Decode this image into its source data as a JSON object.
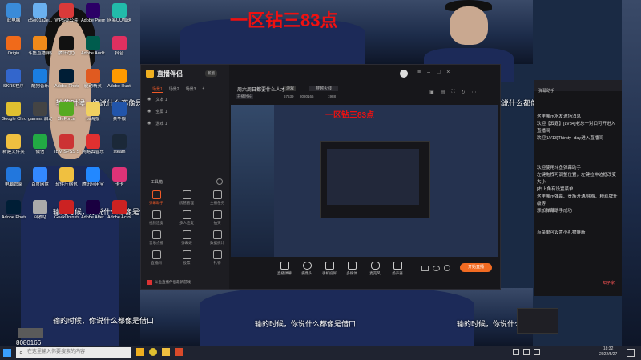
{
  "overlay": {
    "title_text": "一区钻三83点",
    "title_text_small": "一区钻三83点",
    "subtitle": "输的时候，你说什么都像是借口",
    "viewer_count": "8080166",
    "notice_text": "知子家"
  },
  "desktop_icons": [
    {
      "label": "此电脑",
      "color": "#3a8bd9"
    },
    {
      "label": "d5ei01a2e...",
      "color": "#6ab0f0"
    },
    {
      "label": "WPS办公套",
      "color": "#d93a3a"
    },
    {
      "label": "Adobe Premie...",
      "color": "#2b0066"
    },
    {
      "label": "网易UU加速器",
      "color": "#22bbaa"
    },
    {
      "label": "Origin",
      "color": "#f06a1a"
    },
    {
      "label": "斗鱼直播伴侣",
      "color": "#f08a1a"
    },
    {
      "label": "腾讯QQ",
      "color": "#111111"
    },
    {
      "label": "Adobe Audition",
      "color": "#005c4d"
    },
    {
      "label": "抖音",
      "color": "#e03060"
    },
    {
      "label": "SKRS程序",
      "color": "#3366cc"
    },
    {
      "label": "酷狗音乐",
      "color": "#1a7de0"
    },
    {
      "label": "Adobe Photoshop",
      "color": "#001e36"
    },
    {
      "label": "驱动精灵",
      "color": "#e05a20"
    },
    {
      "label": "Adobe Illustrator",
      "color": "#ff9a00"
    },
    {
      "label": "Google Chrome",
      "color": "#e0c030"
    },
    {
      "label": "gamma 启动器",
      "color": "#444444"
    },
    {
      "label": "GeForce",
      "color": "#55aa22"
    },
    {
      "label": "ps海报",
      "color": "#f0d060"
    },
    {
      "label": "豪华版",
      "color": "#2255aa"
    },
    {
      "label": "新建文件夹",
      "color": "#f0c040"
    },
    {
      "label": "微信",
      "color": "#22aa44"
    },
    {
      "label": "IBM SPSS Statistics 26",
      "color": "#cc3333"
    },
    {
      "label": "网易云音乐",
      "color": "#e03030"
    },
    {
      "label": "steam",
      "color": "#1b2838"
    },
    {
      "label": "电脑管家",
      "color": "#2277dd"
    },
    {
      "label": "百度网盘",
      "color": "#3388ff"
    },
    {
      "label": "软件压缩包",
      "color": "#f0c040"
    },
    {
      "label": "腾讯应用宝",
      "color": "#2288ff"
    },
    {
      "label": "卡卡",
      "color": "#dd3377"
    },
    {
      "label": "Adobe Photoshop",
      "color": "#001e36"
    },
    {
      "label": "回收站",
      "color": "#aaaaaa"
    },
    {
      "label": "GeekUninstaller",
      "color": "#cc2222"
    },
    {
      "label": "Adobe After Effects",
      "color": "#1a0040"
    },
    {
      "label": "Adobe Acrobat",
      "color": "#cc2222"
    }
  ],
  "app": {
    "brand": "直播伴侣",
    "badge": "新版",
    "live_title": "周六周日都要什么人才",
    "tag_label": "游戏",
    "category": "穿越火线",
    "stats_label": "开播时长",
    "room_id": "67539",
    "fans": "8080166",
    "hot": "1988",
    "scene_tabs": [
      "场景1",
      "场景2",
      "场景3"
    ],
    "sources": [
      "文本 1",
      "全屏 1",
      "游戏 1"
    ],
    "tools_title": "工具箱",
    "tools": [
      "弹幕助手",
      "房管管理",
      "主播任务",
      "视频连麦",
      "多人连麦",
      "抽奖",
      "音乐点播",
      "弹幕姬",
      "数据统计",
      "直播间",
      "投票",
      "礼物"
    ],
    "promo_text": "斗鱼直播伴侣最新游戏",
    "bottom_buttons": [
      "直播弹幕",
      "摄像头",
      "手机投屏",
      "多媒体",
      "麦克风",
      "扬声器"
    ],
    "start_button": "开始直播"
  },
  "chat": {
    "header": "弹幕助手",
    "messages": [
      "这里展示水友进场消息",
      "欢迎【云霆】[LV34]老总一对口可开进入直播间",
      "欢迎[LV13]Thirsty- day进入直播间",
      "欢迎使用斗鱼弹幕助手",
      "左键拖拽可调整位置，左键拉伸边框改变大小",
      "[右上角有设置菜单",
      "这里展示弹幕、贵族开通/续费、粉丝牌升级等",
      "添加弹幕助手成功",
      "点菜单可设置小礼物屏蔽"
    ]
  },
  "taskbar": {
    "search_placeholder": "在这里输入你要搜索的内容",
    "time": "18:32",
    "date": "2022/5/27"
  }
}
